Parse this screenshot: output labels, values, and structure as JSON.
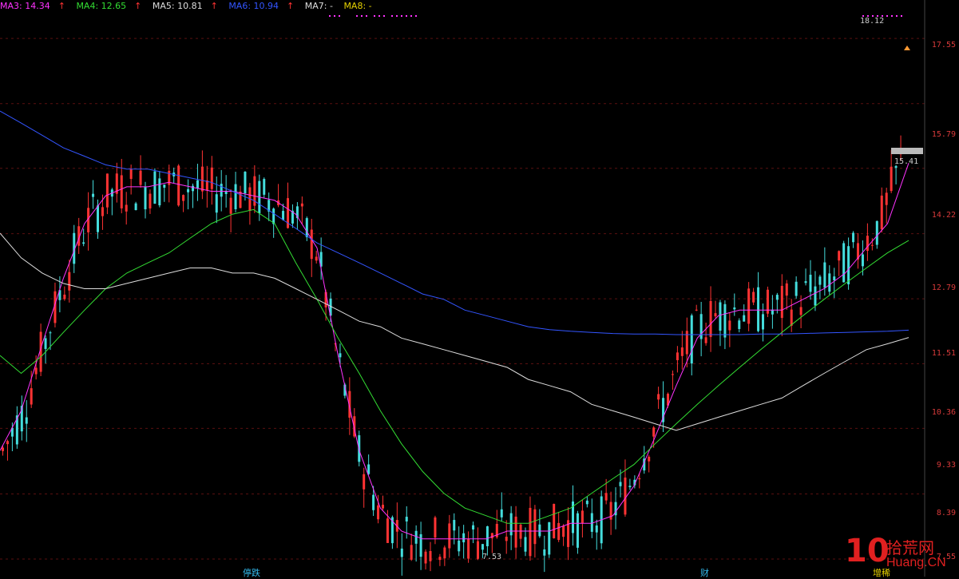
{
  "legend": [
    {
      "text": "MA3: 14.34",
      "arrow": "↑",
      "color": "#ff33ff"
    },
    {
      "text": "MA4: 12.65",
      "arrow": "↑",
      "color": "#33dd33"
    },
    {
      "text": "MA5: 10.81",
      "arrow": "↑",
      "color": "#dddddd"
    },
    {
      "text": "MA6: 10.94",
      "arrow": "↑",
      "color": "#3355ff"
    },
    {
      "text": "MA7: -",
      "arrow": "",
      "color": "#dddddd"
    },
    {
      "text": "MA8: -",
      "arrow": "",
      "color": "#e6d200"
    }
  ],
  "annotations": {
    "high": "18.12",
    "low": "7.53",
    "level": "15.41"
  },
  "bottom_marks": [
    {
      "text": "停跌",
      "color": "#33bbee"
    },
    {
      "text": "财",
      "color": "#33bbee"
    },
    {
      "text": "增稀",
      "color": "#e6d200"
    }
  ],
  "watermark": {
    "big": "10",
    "cn": "拾荒网",
    "url": "Huang.CN"
  },
  "colors": {
    "up": "#ff3333",
    "down": "#44dddd",
    "axis": "#d83a3a"
  },
  "chart_data": {
    "type": "candlestick",
    "y_axis_ticks": [
      "17.55",
      "15.79",
      "14.22",
      "12.79",
      "11.51",
      "10.36",
      "9.33",
      "8.39",
      "7.55"
    ],
    "ylim": [
      7.55,
      18.2
    ],
    "log_scale": true,
    "grid": "horizontal dashed",
    "series": [
      {
        "name": "MA3",
        "color": "#ff33ff",
        "values": [
          9.0,
          9.6,
          10.7,
          11.9,
          13.0,
          13.6,
          13.8,
          13.8,
          13.9,
          13.8,
          13.7,
          13.7,
          13.6,
          13.5,
          13.2,
          12.5,
          10.5,
          9.0,
          8.2,
          7.9,
          7.8,
          7.8,
          7.8,
          7.8,
          7.9,
          7.9,
          7.9,
          8.0,
          8.0,
          8.1,
          8.5,
          9.2,
          10.0,
          10.8,
          11.2,
          11.3,
          11.3,
          11.3,
          11.5,
          11.7,
          12.0,
          12.5,
          13.0,
          14.34
        ]
      },
      {
        "name": "MA4",
        "color": "#33dd33",
        "values": [
          10.5,
          10.2,
          10.5,
          10.9,
          11.3,
          11.7,
          12.0,
          12.2,
          12.4,
          12.7,
          13.0,
          13.2,
          13.3,
          13.0,
          12.2,
          11.5,
          10.8,
          10.2,
          9.6,
          9.1,
          8.7,
          8.4,
          8.2,
          8.1,
          8.0,
          8.0,
          8.1,
          8.2,
          8.4,
          8.6,
          8.8,
          9.1,
          9.4,
          9.7,
          10.0,
          10.3,
          10.6,
          10.9,
          11.2,
          11.5,
          11.8,
          12.1,
          12.4,
          12.65
        ]
      },
      {
        "name": "MA5",
        "color": "#dddddd",
        "values": [
          12.8,
          12.3,
          12.0,
          11.8,
          11.7,
          11.7,
          11.8,
          11.9,
          12.0,
          12.1,
          12.1,
          12.0,
          12.0,
          11.9,
          11.7,
          11.5,
          11.3,
          11.1,
          11.0,
          10.8,
          10.7,
          10.6,
          10.5,
          10.4,
          10.3,
          10.1,
          10.0,
          9.9,
          9.7,
          9.6,
          9.5,
          9.4,
          9.3,
          9.4,
          9.5,
          9.6,
          9.7,
          9.8,
          10.0,
          10.2,
          10.4,
          10.6,
          10.7,
          10.81
        ]
      },
      {
        "name": "MA6",
        "color": "#3355ff",
        "values": [
          15.6,
          15.3,
          15.0,
          14.7,
          14.5,
          14.3,
          14.2,
          14.2,
          14.1,
          14.0,
          13.9,
          13.7,
          13.5,
          13.2,
          12.9,
          12.6,
          12.4,
          12.2,
          12.0,
          11.8,
          11.6,
          11.5,
          11.3,
          11.2,
          11.1,
          11.0,
          10.95,
          10.92,
          10.9,
          10.88,
          10.87,
          10.87,
          10.86,
          10.86,
          10.86,
          10.86,
          10.87,
          10.87,
          10.88,
          10.89,
          10.9,
          10.91,
          10.92,
          10.94
        ]
      }
    ]
  }
}
